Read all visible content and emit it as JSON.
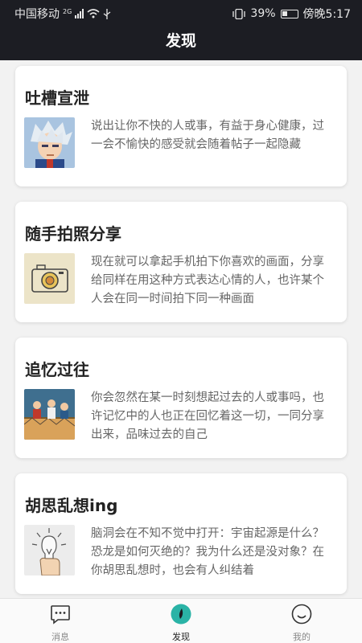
{
  "status_bar": {
    "carrier": "中国移动",
    "network": "2G",
    "battery": "39%",
    "time": "傍晚5:17"
  },
  "header": {
    "title": "发现"
  },
  "cards": [
    {
      "title": "吐槽宣泄",
      "description": "说出让你不快的人或事，有益于身心健康，过一会不愉快的感受就会随着帖子一起隐藏",
      "thumb_icon": "anime-portrait-image"
    },
    {
      "title": "随手拍照分享",
      "description": "现在就可以拿起手机拍下你喜欢的画面，分享给同样在用这种方式表达心情的人，也许某个人会在同一时间拍下同一种画面",
      "thumb_icon": "camera-sketch-image"
    },
    {
      "title": "追忆过往",
      "description": "你会忽然在某一时刻想起过去的人或事吗，也许记忆中的人也正在回忆着这一切，一同分享出来，品味过去的自己",
      "thumb_icon": "nostalgia-illustration-image"
    },
    {
      "title": "胡思乱想ing",
      "description": "脑洞会在不知不觉中打开：宇宙起源是什么？恐龙是如何灭绝的？我为什么还是没对象？在你胡思乱想时，也会有人纠结着",
      "thumb_icon": "lightbulb-hand-image"
    }
  ],
  "tabbar": {
    "items": [
      {
        "label": "消息",
        "icon": "message-bubble-icon"
      },
      {
        "label": "发现",
        "icon": "discover-icon",
        "active": true
      },
      {
        "label": "我的",
        "icon": "smiley-profile-icon"
      }
    ],
    "active_color": "#2ab3a6"
  }
}
